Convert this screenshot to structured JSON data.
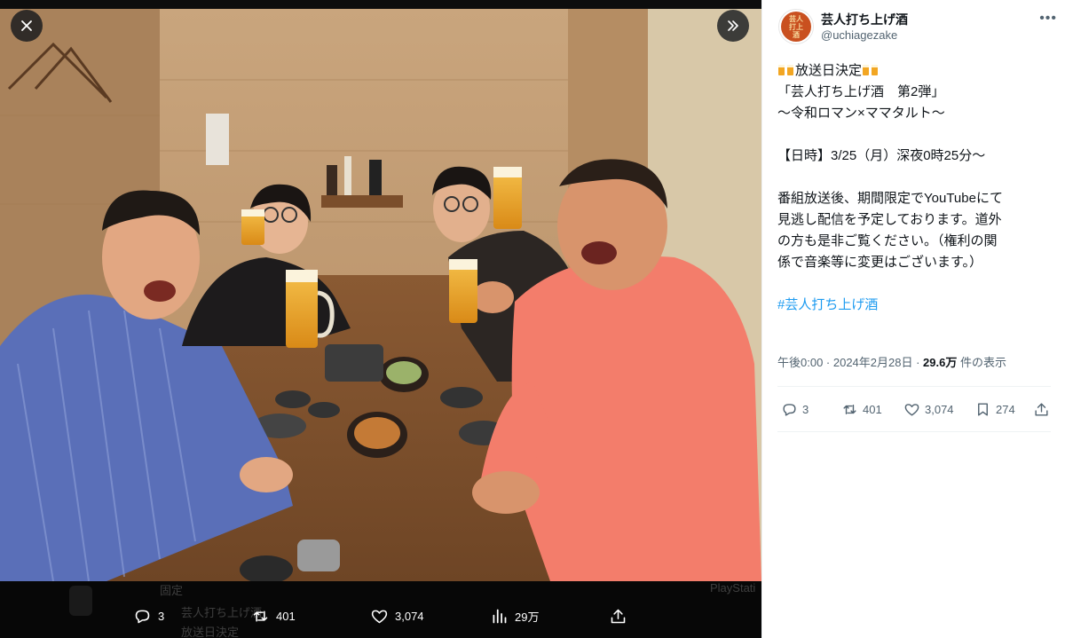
{
  "media": {
    "overlay_actions": [
      {
        "icon": "reply-icon",
        "count": "3"
      },
      {
        "icon": "retweet-icon",
        "count": "401"
      },
      {
        "icon": "like-icon",
        "count": "3,074"
      },
      {
        "icon": "views-icon",
        "count": "29万"
      },
      {
        "icon": "share-icon",
        "count": ""
      }
    ],
    "background_tweet": {
      "header": "固定",
      "author": "芸人打ち上げ酒",
      "snippet": "放送日決定",
      "side_label": "PlayStati"
    }
  },
  "tweet": {
    "author_name": "芸人打ち上げ酒",
    "author_handle": "@uchiagezake",
    "avatar_text": "芸人打ち上げ酒",
    "lines": [
      "放送日決定",
      "「芸人打ち上げ酒　第2弾」",
      "〜令和ロマン×ママタルト〜",
      "",
      "【日時】3/25（月）深夜0時25分〜",
      "",
      "番組放送後、期間限定でYouTubeにて",
      "見逃し配信を予定しております。道外",
      "の方も是非ご覧ください。（権利の関",
      "係で音楽等に変更はございます。）",
      ""
    ],
    "hashtag": "#芸人打ち上げ酒",
    "timestamp": "午後0:00 · 2024年2月28日 · ",
    "views_count": "29.6万",
    "views_label": " 件の表示",
    "stats": {
      "replies": "3",
      "retweets": "401",
      "likes": "3,074",
      "bookmarks": "274"
    }
  },
  "colors": {
    "accent": "#1d9bf0",
    "text_primary": "#0f1419",
    "text_secondary": "#536471"
  }
}
